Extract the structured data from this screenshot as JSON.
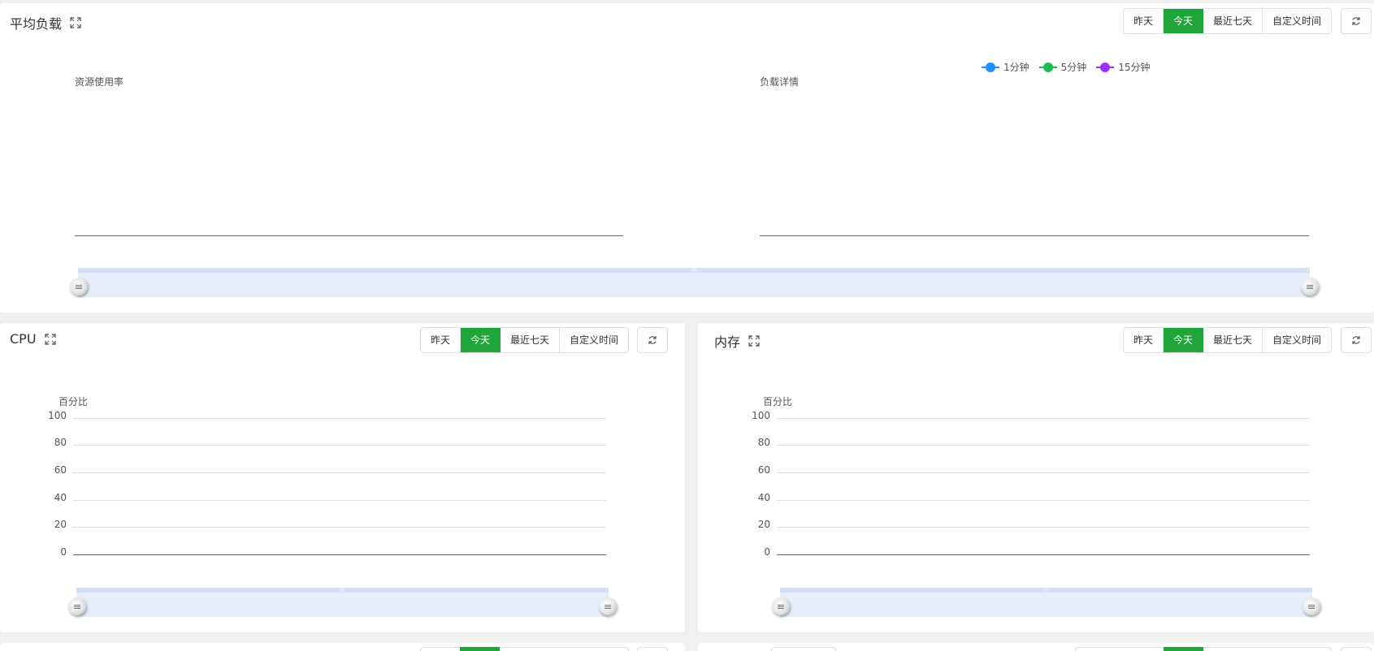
{
  "time_buttons": [
    "昨天",
    "今天",
    "最近七天",
    "自定义时间"
  ],
  "active_time_button": "今天",
  "load_panel": {
    "title": "平均负载",
    "left_chart_label": "资源使用率",
    "right_chart_label": "负载详情",
    "legend": [
      {
        "name": "1分钟",
        "color": "#1e90ff"
      },
      {
        "name": "5分钟",
        "color": "#1db954"
      },
      {
        "name": "15分钟",
        "color": "#9b30ff"
      }
    ]
  },
  "cpu_panel": {
    "title": "CPU",
    "y_label": "百分比",
    "y_ticks": [
      "100",
      "80",
      "60",
      "40",
      "20",
      "0"
    ]
  },
  "memory_panel": {
    "title": "内存",
    "y_label": "百分比",
    "y_ticks": [
      "100",
      "80",
      "60",
      "40",
      "20",
      "0"
    ]
  },
  "colors": {
    "accent": "#20a53a",
    "datazoom_fill": "#e6edfb"
  }
}
